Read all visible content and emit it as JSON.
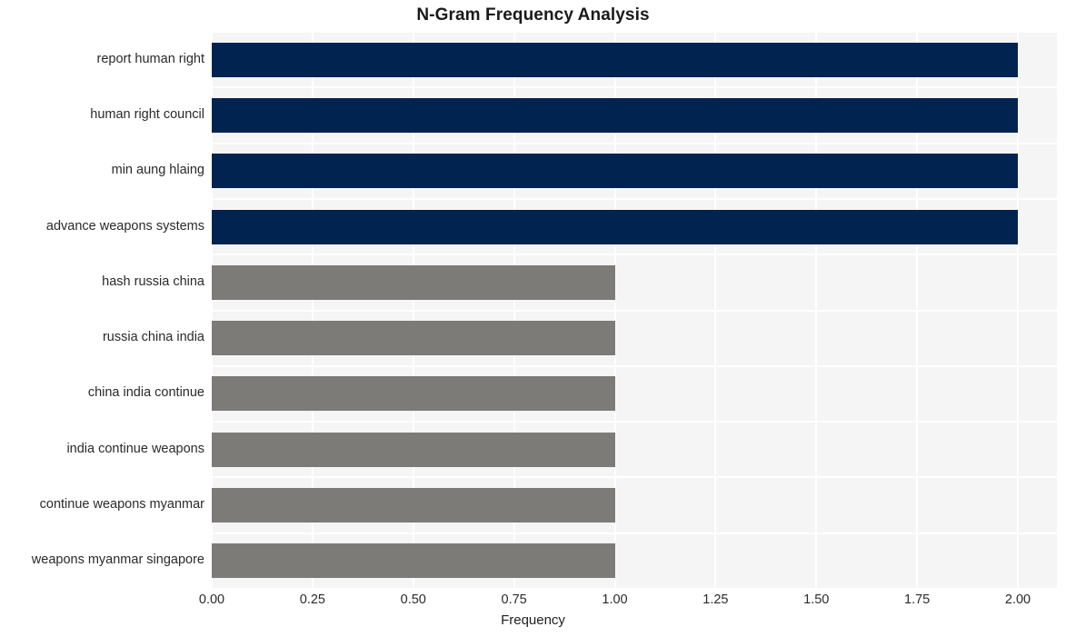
{
  "chart_data": {
    "type": "bar",
    "orientation": "horizontal",
    "title": "N-Gram Frequency Analysis",
    "xlabel": "Frequency",
    "ylabel": "",
    "xlim": [
      0,
      2.0
    ],
    "grid": true,
    "legend": null,
    "categories": [
      "report human right",
      "human right council",
      "min aung hlaing",
      "advance weapons systems",
      "hash russia china",
      "russia china india",
      "china india continue",
      "india continue weapons",
      "continue weapons myanmar",
      "weapons myanmar singapore"
    ],
    "values": [
      2,
      2,
      2,
      2,
      1,
      1,
      1,
      1,
      1,
      1
    ],
    "bar_colors": [
      "#00234f",
      "#00234f",
      "#00234f",
      "#00234f",
      "#7c7b78",
      "#7c7b78",
      "#7c7b78",
      "#7c7b78",
      "#7c7b78",
      "#7c7b78"
    ],
    "xticks": [
      "0.00",
      "0.25",
      "0.50",
      "0.75",
      "1.00",
      "1.25",
      "1.50",
      "1.75",
      "2.00"
    ],
    "xtick_values": [
      0,
      0.25,
      0.5,
      0.75,
      1.0,
      1.25,
      1.5,
      1.75,
      2.0
    ],
    "plot_background": "#f5f5f6",
    "gridline_color": "#ffffff",
    "figure_background": "#ffffff"
  }
}
